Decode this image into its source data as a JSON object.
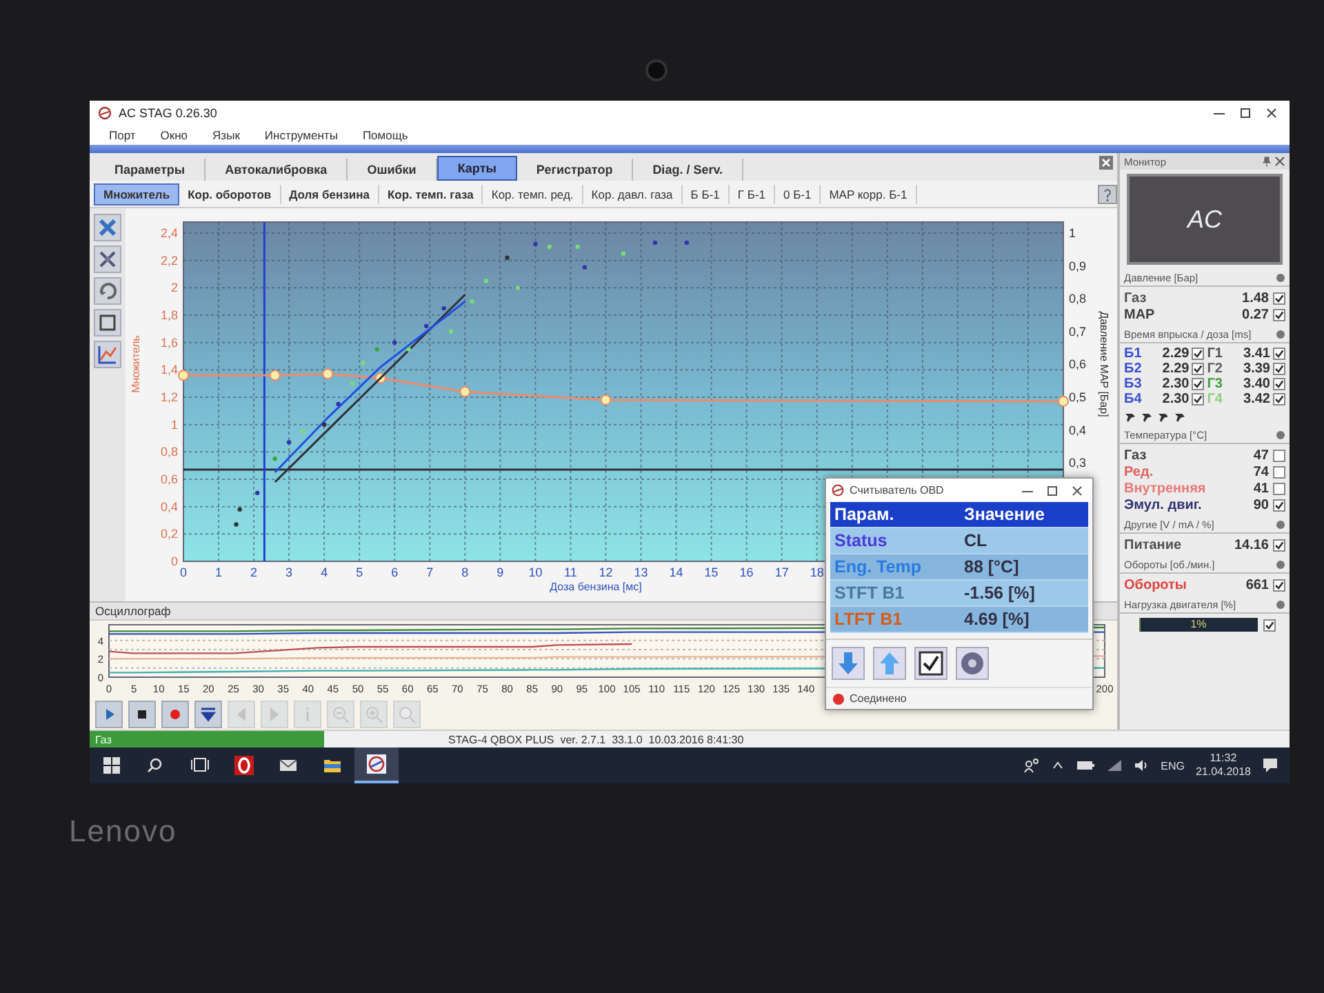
{
  "window": {
    "title": "AC STAG 0.26.30"
  },
  "menu": [
    "Порт",
    "Окно",
    "Язык",
    "Инструменты",
    "Помощь"
  ],
  "tabs": [
    {
      "label": "Параметры",
      "selected": false
    },
    {
      "label": "Автокалибровка",
      "selected": false
    },
    {
      "label": "Ошибки",
      "selected": false
    },
    {
      "label": "Карты",
      "selected": true
    },
    {
      "label": "Регистратор",
      "selected": false
    },
    {
      "label": "Diag. / Serv.",
      "selected": false
    }
  ],
  "sub_tabs": [
    {
      "label": "Множитель",
      "selected": true,
      "bold": true
    },
    {
      "label": "Кор. оборотов",
      "selected": false,
      "bold": true
    },
    {
      "label": "Доля бензина",
      "selected": false,
      "bold": true
    },
    {
      "label": "Кор. темп. газа",
      "selected": false,
      "bold": true
    },
    {
      "label": "Кор. темп. ред.",
      "selected": false,
      "bold": false
    },
    {
      "label": "Кор. давл. газа",
      "selected": false,
      "bold": false
    },
    {
      "label": "Б Б-1",
      "selected": false,
      "bold": false
    },
    {
      "label": "Г Б-1",
      "selected": false,
      "bold": false
    },
    {
      "label": "0 Б-1",
      "selected": false,
      "bold": false
    },
    {
      "label": "MAP корр. Б-1",
      "selected": false,
      "bold": false
    }
  ],
  "map_chart": {
    "chart_data": {
      "type": "line",
      "xlabel": "Доза бензина [мс]",
      "ylabel": "Множитель",
      "y2label": "Давление MAP [Бар]",
      "xlim": [
        0,
        25
      ],
      "ylim": [
        0,
        2.4
      ],
      "y2lim": [
        0,
        1
      ],
      "x": [
        0,
        2.6,
        4.1,
        5.6,
        8,
        12,
        25
      ],
      "xticks": [
        0,
        1,
        2,
        3,
        4,
        5,
        6,
        7,
        8,
        9,
        10,
        11,
        12,
        13,
        14,
        15,
        16,
        17,
        18
      ],
      "yticks": [
        {
          "value": 0,
          "label": "0"
        },
        {
          "value": 0.2,
          "label": "0,2"
        },
        {
          "value": 0.4,
          "label": "0,4"
        },
        {
          "value": 0.6,
          "label": "0,6"
        },
        {
          "value": 0.8,
          "label": "0,8"
        },
        {
          "value": 1,
          "label": "1"
        },
        {
          "value": 1.2,
          "label": "1,2"
        },
        {
          "value": 1.4,
          "label": "1,4"
        },
        {
          "value": 1.6,
          "label": "1,6"
        },
        {
          "value": 1.8,
          "label": "1,8"
        },
        {
          "value": 2,
          "label": "2"
        },
        {
          "value": 2.2,
          "label": "2,2"
        },
        {
          "value": 2.4,
          "label": "2,4"
        }
      ],
      "y2ticks": [
        {
          "value": 0.3,
          "label": "0,3"
        },
        {
          "value": 0.4,
          "label": "0,4"
        },
        {
          "value": 0.5,
          "label": "0,5"
        },
        {
          "value": 0.6,
          "label": "0,6"
        },
        {
          "value": 0.7,
          "label": "0,7"
        },
        {
          "value": 0.8,
          "label": "0,8"
        },
        {
          "value": 0.9,
          "label": "0,9"
        },
        {
          "value": 1,
          "label": "1"
        }
      ],
      "series": [
        {
          "color": "#f08a6a",
          "marker": "circle",
          "values": [
            1.36,
            1.36,
            1.37,
            1.34,
            1.24,
            1.18,
            1.17
          ]
        },
        {
          "color": "#303038",
          "values": [
            null,
            0.58,
            0.96,
            1.34,
            1.95,
            null,
            null
          ]
        },
        {
          "color": "#2050e0",
          "values": [
            null,
            0.65,
            1.05,
            1.42,
            1.9,
            null,
            null
          ]
        }
      ],
      "grid": true,
      "ref_lines": [
        {
          "axis": "y",
          "value": 0.67
        },
        {
          "axis": "x",
          "value": 2.3
        }
      ]
    }
  },
  "oscillograph": {
    "title": "Осциллограф",
    "chart_data": {
      "type": "line",
      "xlim": [
        0,
        200
      ],
      "ylim": [
        0,
        5.4
      ],
      "x": [
        0,
        5,
        25,
        42,
        50,
        85,
        90,
        105,
        200
      ],
      "xticks": [
        0,
        5,
        10,
        15,
        20,
        25,
        30,
        35,
        40,
        45,
        50,
        55,
        60,
        65,
        70,
        75,
        80,
        85,
        90,
        95,
        100,
        105,
        110,
        115,
        120,
        125,
        130,
        135,
        140,
        200
      ],
      "yticks": [
        0,
        2,
        4
      ],
      "series": [
        {
          "color": "#3a8a3a",
          "values": [
            5.0,
            5.0,
            5.0,
            5.1,
            5.1,
            5.2,
            5.2,
            5.3,
            5.4
          ]
        },
        {
          "color": "#3050c0",
          "values": [
            4.7,
            4.7,
            4.7,
            4.8,
            4.8,
            4.8,
            4.8,
            4.9,
            4.9
          ]
        },
        {
          "color": "#c05050",
          "values": [
            2.8,
            2.6,
            2.6,
            3.2,
            3.3,
            3.3,
            3.5,
            3.6,
            null
          ]
        },
        {
          "color": "#e8b898",
          "values": [
            2.0,
            2.0,
            2.0,
            2.1,
            2.1,
            2.1,
            2.2,
            2.2,
            2.3
          ]
        },
        {
          "color": "#40b0b0",
          "values": [
            0.5,
            0.5,
            0.6,
            0.7,
            0.7,
            0.8,
            0.8,
            0.9,
            1.0
          ]
        }
      ],
      "grid": true
    },
    "buttons": [
      {
        "kind": "play",
        "disabled": false
      },
      {
        "kind": "stop",
        "disabled": false
      },
      {
        "kind": "record",
        "disabled": false
      },
      {
        "kind": "down",
        "disabled": false
      },
      {
        "kind": "left",
        "disabled": true
      },
      {
        "kind": "right",
        "disabled": true
      },
      {
        "kind": "info",
        "disabled": true
      },
      {
        "kind": "zoom-out",
        "disabled": true
      },
      {
        "kind": "zoom-in",
        "disabled": true
      },
      {
        "kind": "zoom-fit",
        "disabled": true
      }
    ]
  },
  "status_bar": {
    "mode": "Газ",
    "info": "STAG-4 QBOX PLUS  ver. 2.7.1  33.1.0  10.03.2016 8:41:30"
  },
  "monitor": {
    "title": "Монитор",
    "logo": "AC",
    "sections": [
      {
        "title": "Давление [Бар]",
        "kind": "rows",
        "rows": [
          {
            "label": "Газ",
            "value": "1.48",
            "checked": true,
            "color": "#505050"
          },
          {
            "label": "MAP",
            "value": "0.27",
            "checked": true,
            "color": "#404040"
          }
        ]
      },
      {
        "title": "Время впрыска / доза [ms]",
        "kind": "injectors",
        "cells": [
          {
            "label": "Б1",
            "value": "2.29",
            "checked": true,
            "color": "#3a4fd0"
          },
          {
            "label": "Г1",
            "value": "3.41",
            "checked": true,
            "color": "#505050"
          },
          {
            "label": "Б2",
            "value": "2.29",
            "checked": true,
            "color": "#3a4fd0"
          },
          {
            "label": "Г2",
            "value": "3.39",
            "checked": true,
            "color": "#606060"
          },
          {
            "label": "Б3",
            "value": "2.30",
            "checked": true,
            "color": "#3a4fd0"
          },
          {
            "label": "Г3",
            "value": "3.40",
            "checked": true,
            "color": "#40a040"
          },
          {
            "label": "Б4",
            "value": "2.30",
            "checked": true,
            "color": "#3a4fd0"
          },
          {
            "label": "Г4",
            "value": "3.42",
            "checked": true,
            "color": "#90d080"
          }
        ]
      },
      {
        "title": "Температура [°C]",
        "kind": "rows",
        "rows": [
          {
            "label": "Газ",
            "value": "47",
            "checked": false,
            "color": "#404040"
          },
          {
            "label": "Ред.",
            "value": "74",
            "checked": false,
            "color": "#e06060"
          },
          {
            "label": "Внутренняя",
            "value": "41",
            "checked": false,
            "color": "#e87878"
          },
          {
            "label": "Эмул. двиг.",
            "value": "90",
            "checked": true,
            "color": "#303070"
          }
        ]
      },
      {
        "title": "Другие [V / mA / %]",
        "kind": "rows",
        "rows": [
          {
            "label": "Питание",
            "value": "14.16",
            "checked": true,
            "color": "#505050"
          }
        ]
      },
      {
        "title": "Обороты [об./мин.]",
        "kind": "rows",
        "rows": [
          {
            "label": "Обороты",
            "value": "661",
            "checked": true,
            "color": "#e04040"
          }
        ]
      },
      {
        "title": "Нагрузка двигателя [%]",
        "kind": "bar",
        "bar": {
          "level": 0.01,
          "reading": "1%",
          "checked": true
        }
      }
    ]
  },
  "obd_window": {
    "title": "Считыватель OBD",
    "columns": [
      "Парам.",
      "Значение"
    ],
    "rows": [
      {
        "param": "Status",
        "value": "CL",
        "color": "#4a3ad8"
      },
      {
        "param": "Eng. Temp",
        "value": "88 [°C]",
        "color": "#2a7ae0"
      },
      {
        "param": "STFT B1",
        "value": "-1.56 [%]",
        "color": "#4a7a98"
      },
      {
        "param": "LTFT B1",
        "value": "4.69 [%]",
        "color": "#d85a14"
      }
    ],
    "buttons": [
      {
        "kind": "down"
      },
      {
        "kind": "up"
      },
      {
        "kind": "check",
        "checked": true
      },
      {
        "kind": "gear"
      }
    ],
    "status": {
      "text": "Соединено",
      "color": "#e03030"
    }
  },
  "taskbar": {
    "apps": [
      {
        "kind": "search",
        "active": false
      },
      {
        "kind": "task-view",
        "active": false
      },
      {
        "kind": "opera",
        "active": false
      },
      {
        "kind": "mail",
        "active": false
      },
      {
        "kind": "explorer",
        "active": false
      },
      {
        "kind": "ac",
        "active": true
      }
    ],
    "language": "ENG",
    "time": "11:32",
    "date": "21.04.2018"
  },
  "laptop": {
    "brand": "Lenovo"
  }
}
